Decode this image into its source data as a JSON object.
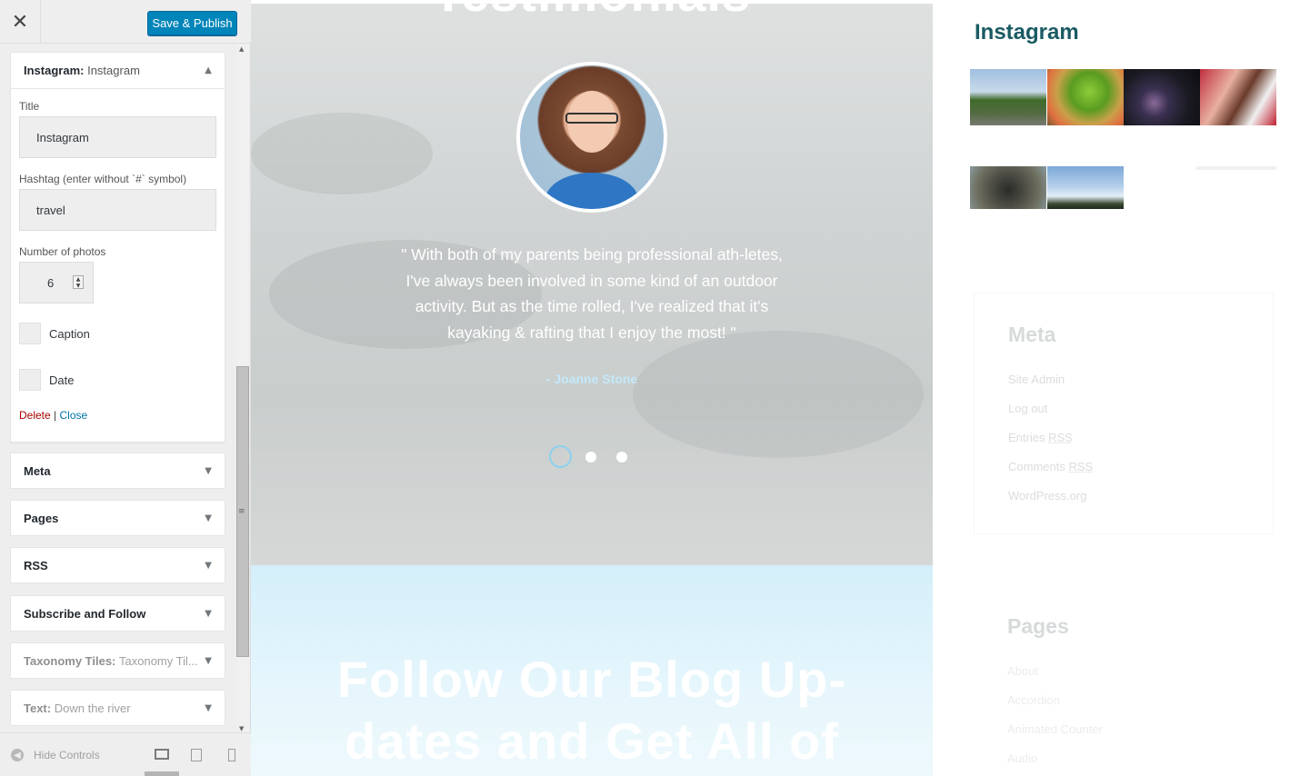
{
  "topbar": {
    "close_glyph": "✕",
    "publish_label": "Save & Publish"
  },
  "widget_instagram": {
    "head_prefix": "Instagram:",
    "head_title": "Instagram",
    "title_label": "Title",
    "title_value": "Instagram",
    "hashtag_label": "Hashtag (enter without `#` symbol)",
    "hashtag_value": "travel",
    "photos_label": "Number of photos",
    "photos_value": "6",
    "caption_label": "Caption",
    "date_label": "Date",
    "delete_label": "Delete",
    "separator": "|",
    "close_label": "Close"
  },
  "widgets": [
    {
      "label": "Meta",
      "sub": ""
    },
    {
      "label": "Pages",
      "sub": ""
    },
    {
      "label": "RSS",
      "sub": ""
    },
    {
      "label": "Subscribe and Follow",
      "sub": ""
    },
    {
      "label": "Taxonomy Tiles:",
      "sub": "Taxonomy Til..."
    },
    {
      "label": "Text:",
      "sub": "Down the river"
    }
  ],
  "footer": {
    "hide_controls_label": "Hide Controls",
    "active_device": "desktop"
  },
  "preview": {
    "heading_partial": "Testimonials",
    "quote": "\" With both of my parents being professional ath-letes, I've always been involved in some kind of an outdoor activity. But as the time rolled, I've realized that it's kayaking & rafting that I enjoy the most! \"",
    "author": "- Joanne Stone",
    "slider_dots": 3,
    "slider_active": 1,
    "blog_title_line1": "Follow Our Blog Up-",
    "blog_title_line2": "dates and Get All of"
  },
  "sidebar_right": {
    "instagram_title": "Instagram",
    "photos": [
      {
        "name": "road-trees-photo"
      },
      {
        "name": "lime-fruit-photo"
      },
      {
        "name": "city-night-photo"
      },
      {
        "name": "person-sign-photo"
      },
      {
        "name": "rocks-photo"
      },
      {
        "name": "sky-hills-photo"
      }
    ],
    "meta_title": "Meta",
    "meta_links": [
      "Site Admin",
      "Log out",
      "Entries",
      "Comments",
      "WordPress.org"
    ],
    "rss_abbr": "RSS",
    "pages_title": "Pages",
    "pages_links": [
      "About",
      "Accordion",
      "Animated Counter",
      "Audio"
    ]
  },
  "colors": {
    "publish_blue": "#0085ba",
    "delete_red": "#aa0000",
    "link_blue": "#0073aa",
    "instagram_title": "#1a5a63",
    "author_blue": "#c4e9fb"
  }
}
